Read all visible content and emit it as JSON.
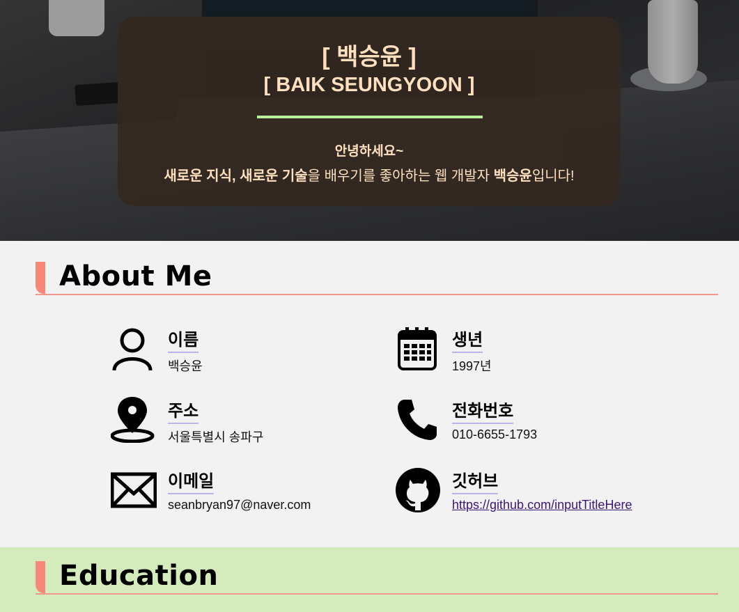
{
  "hero": {
    "name_ko": "[ 백승윤 ]",
    "name_en": "[ BAIK SEUNGYOON ]",
    "greeting": "안녕하세요~",
    "intro_bold1": "새로운 지식, 새로운 기술",
    "intro_mid": "을 배우기를 좋아하는 웹 개발자 ",
    "intro_bold2": "백승윤",
    "intro_end": "입니다!",
    "accent_color": "#b9ef9a",
    "card_color": "#342820"
  },
  "about": {
    "title": "About Me",
    "items": [
      {
        "icon": "person-icon",
        "label": "이름",
        "value": "백승윤"
      },
      {
        "icon": "calendar-icon",
        "label": "생년",
        "value": "1997년"
      },
      {
        "icon": "map-pin-icon",
        "label": "주소",
        "value": "서울특별시 송파구"
      },
      {
        "icon": "phone-icon",
        "label": "전화번호",
        "value": "010-6655-1793"
      },
      {
        "icon": "mail-icon",
        "label": "이메일",
        "value": "seanbryan97@naver.com"
      },
      {
        "icon": "github-icon",
        "label": "깃허브",
        "value": "https://github.com/inputTitleHere"
      }
    ]
  },
  "education": {
    "title": "Education"
  },
  "colors": {
    "section_bar": "#f7897b",
    "label_underline": "#b8b5ec",
    "education_bg": "#d5ebbe",
    "link": "#3b1573"
  }
}
